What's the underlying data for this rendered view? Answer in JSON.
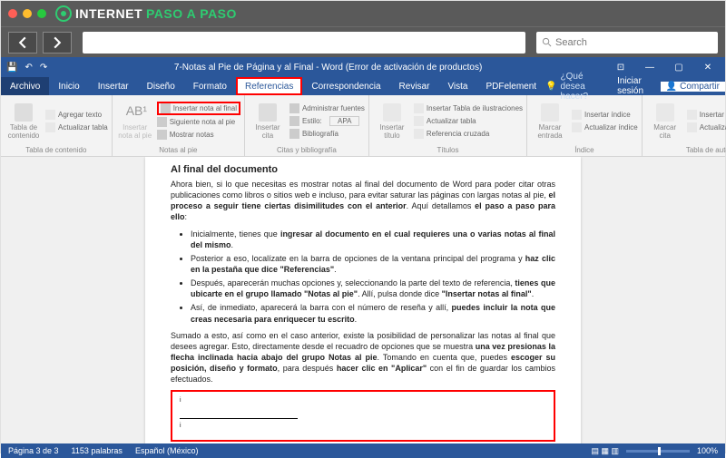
{
  "browser": {
    "logo_prefix": "INTERNET",
    "logo_mid": "PASO",
    "logo_suffix": "A",
    "logo_end": "PASO",
    "search_placeholder": "Search"
  },
  "word": {
    "title": "7-Notas al Pie de Página y al Final - Word (Error de activación de productos)",
    "qat": {
      "save": "💾",
      "undo": "↶",
      "redo": "↷"
    },
    "tabs": {
      "file": "Archivo",
      "home": "Inicio",
      "insert": "Insertar",
      "design": "Diseño",
      "layout": "Formato",
      "references": "Referencias",
      "mailings": "Correspondencia",
      "review": "Revisar",
      "view": "Vista",
      "pdf": "PDFelement",
      "tellme": "¿Qué desea hacer?",
      "signin": "Iniciar sesión",
      "share": "Compartir"
    },
    "ribbon": {
      "toc": {
        "big": "Tabla de\ncontenido",
        "add_text": "Agregar texto",
        "update": "Actualizar tabla",
        "group": "Tabla de contenido"
      },
      "foot": {
        "big": "Insertar\nnota al pie",
        "endnote": "Insertar nota al final",
        "next": "Siguiente nota al pie",
        "show": "Mostrar notas",
        "group": "Notas al pie"
      },
      "cite": {
        "big": "Insertar\ncita",
        "manage": "Administrar fuentes",
        "style": "Estilo:",
        "value": "APA",
        "bib": "Bibliografía",
        "group": "Citas y bibliografía"
      },
      "cap": {
        "big": "Insertar\ntítulo",
        "table_figs": "Insertar Tabla de ilustraciones",
        "update": "Actualizar tabla",
        "cross": "Referencia cruzada",
        "group": "Títulos"
      },
      "idx": {
        "big": "Marcar\nentrada",
        "insert": "Insertar índice",
        "update": "Actualizar índice",
        "group": "Índice"
      },
      "auth": {
        "big": "Marcar\ncita",
        "insert": "Insertar Tabla de autoridades",
        "update": "Actualizar tabla",
        "group": "Tabla de autoridades"
      }
    },
    "status": {
      "page": "Página 3 de 3",
      "words": "1153 palabras",
      "lang": "Español (México)",
      "zoom": "100%"
    }
  },
  "doc": {
    "heading": "Al final del documento",
    "p1a": "Ahora bien, si lo que necesitas es mostrar notas al final del documento de Word para poder citar otras publicaciones como libros o sitios web e incluso, para evitar saturar las páginas con largas notas al pie, ",
    "p1b": "el proceso a seguir tiene ciertas disimilitudes con el anterior",
    "p1c": ". Aquí detallamos ",
    "p1d": "el paso a paso para ello",
    "p1e": ":",
    "li1a": "Inicialmente, tienes que ",
    "li1b": "ingresar al documento en el cual requieres una o varias notas al final del mismo",
    "li1c": ".",
    "li2a": "Posterior a eso, localízate en la barra de opciones de la ventana principal del programa y ",
    "li2b": "haz clic en la pestaña que dice \"Referencias\"",
    "li2c": ".",
    "li3a": "Después, aparecerán muchas opciones y, seleccionando la parte del texto de referencia, ",
    "li3b": "tienes que ubicarte en el grupo llamado \"Notas al pie\"",
    "li3c": ". Allí, pulsa donde dice ",
    "li3d": "\"Insertar notas al final\"",
    "li3e": ".",
    "li4a": "Así, de inmediato, aparecerá la barra con el número de reseña y allí, ",
    "li4b": "puedes incluir la nota que creas necesaria para enriquecer tu escrito",
    "li4c": ".",
    "p2a": "Sumado a esto, así como en el caso anterior, existe la posibilidad de personalizar las notas al final que desees agregar. Esto, directamente desde el recuadro de opciones que se muestra ",
    "p2b": "una vez presionas la flecha inclinada hacia abajo del grupo Notas al pie",
    "p2c": ". Tomando en cuenta que, puedes ",
    "p2d": "escoger su posición, diseño y formato",
    "p2e": ", para después ",
    "p2f": "hacer clic en \"Aplicar\"",
    "p2g": " con el fin de guardar los cambios efectuados.",
    "mark": "i"
  }
}
